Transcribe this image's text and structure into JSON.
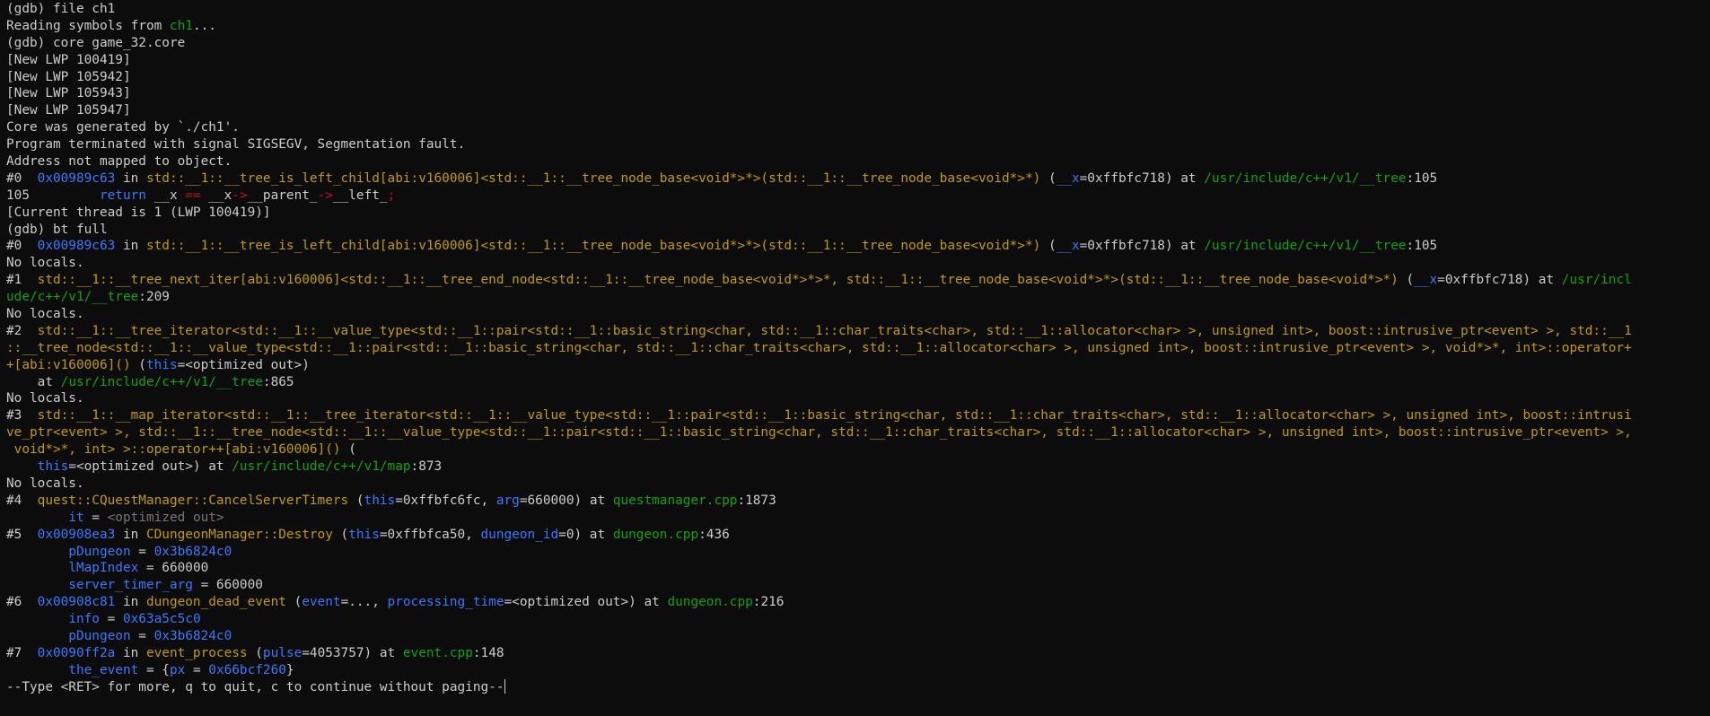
{
  "window": {
    "type": "terminal",
    "program": "gdb"
  },
  "colors": {
    "background": "#0c0c0c",
    "default": "#cccccc",
    "function": "#c19c00",
    "address": "#3b78ff",
    "parameter": "#3b78ff",
    "file": "#13a10e",
    "operator": "#c50f1f",
    "keyword": "#3b78ff",
    "variable": "#3b78ff",
    "dim": "#767676"
  },
  "lines": [
    [
      {
        "t": "(gdb) file ch1",
        "c": "default"
      }
    ],
    [
      {
        "t": "Reading symbols from ",
        "c": "default"
      },
      {
        "t": "ch1",
        "c": "file"
      },
      {
        "t": "...",
        "c": "default"
      }
    ],
    [
      {
        "t": "(gdb) core game_32.core",
        "c": "default"
      }
    ],
    [
      {
        "t": "[New LWP 100419]",
        "c": "default"
      }
    ],
    [
      {
        "t": "[New LWP 105942]",
        "c": "default"
      }
    ],
    [
      {
        "t": "[New LWP 105943]",
        "c": "default"
      }
    ],
    [
      {
        "t": "[New LWP 105947]",
        "c": "default"
      }
    ],
    [
      {
        "t": "Core was generated by `./ch1'.",
        "c": "default"
      }
    ],
    [
      {
        "t": "Program terminated with signal SIGSEGV, Segmentation fault.",
        "c": "default"
      }
    ],
    [
      {
        "t": "Address not mapped to object.",
        "c": "default"
      }
    ],
    [
      {
        "t": "#0  ",
        "c": "default"
      },
      {
        "t": "0x00989c63",
        "c": "addr"
      },
      {
        "t": " in ",
        "c": "default"
      },
      {
        "t": "std::__1::__tree_is_left_child[abi:v160006]<std::__1::__tree_node_base<void*>*>(std::__1::__tree_node_base<void*>*)",
        "c": "fn"
      },
      {
        "t": " (",
        "c": "default"
      },
      {
        "t": "__x",
        "c": "param"
      },
      {
        "t": "=0xffbfc718) at ",
        "c": "default"
      },
      {
        "t": "/usr/include/c++/v1/__tree",
        "c": "file"
      },
      {
        "t": ":105",
        "c": "default"
      }
    ],
    [
      {
        "t": "105\t    ",
        "c": "default"
      },
      {
        "t": "return",
        "c": "kw"
      },
      {
        "t": " __x ",
        "c": "default"
      },
      {
        "t": "==",
        "c": "op"
      },
      {
        "t": " __x",
        "c": "default"
      },
      {
        "t": "->",
        "c": "op"
      },
      {
        "t": "__parent_",
        "c": "default"
      },
      {
        "t": "->",
        "c": "op"
      },
      {
        "t": "__left_",
        "c": "default"
      },
      {
        "t": ";",
        "c": "op"
      }
    ],
    [
      {
        "t": "[Current thread is 1 (LWP 100419)]",
        "c": "default"
      }
    ],
    [
      {
        "t": "(gdb) bt full",
        "c": "default"
      }
    ],
    [
      {
        "t": "#0  ",
        "c": "default"
      },
      {
        "t": "0x00989c63",
        "c": "addr"
      },
      {
        "t": " in ",
        "c": "default"
      },
      {
        "t": "std::__1::__tree_is_left_child[abi:v160006]<std::__1::__tree_node_base<void*>*>(std::__1::__tree_node_base<void*>*)",
        "c": "fn"
      },
      {
        "t": " (",
        "c": "default"
      },
      {
        "t": "__x",
        "c": "param"
      },
      {
        "t": "=0xffbfc718) at ",
        "c": "default"
      },
      {
        "t": "/usr/include/c++/v1/__tree",
        "c": "file"
      },
      {
        "t": ":105",
        "c": "default"
      }
    ],
    [
      {
        "t": "No locals.",
        "c": "default"
      }
    ],
    [
      {
        "t": "#1  ",
        "c": "default"
      },
      {
        "t": "std::__1::__tree_next_iter[abi:v160006]<std::__1::__tree_end_node<std::__1::__tree_node_base<void*>*>*, std::__1::__tree_node_base<void*>*>(std::__1::__tree_node_base<void*>*)",
        "c": "fn"
      },
      {
        "t": " (",
        "c": "default"
      },
      {
        "t": "__x",
        "c": "param"
      },
      {
        "t": "=0xffbfc718) at ",
        "c": "default"
      },
      {
        "t": "/usr/incl",
        "c": "file"
      }
    ],
    [
      {
        "t": "ude/c++/v1/__tree",
        "c": "file"
      },
      {
        "t": ":209",
        "c": "default"
      }
    ],
    [
      {
        "t": "No locals.",
        "c": "default"
      }
    ],
    [
      {
        "t": "#2  ",
        "c": "default"
      },
      {
        "t": "std::__1::__tree_iterator<std::__1::__value_type<std::__1::pair<std::__1::basic_string<char, std::__1::char_traits<char>, std::__1::allocator<char> >, unsigned int>, boost::intrusive_ptr<event> >, std::__1",
        "c": "fn"
      }
    ],
    [
      {
        "t": "::__tree_node<std::__1::__value_type<std::__1::pair<std::__1::basic_string<char, std::__1::char_traits<char>, std::__1::allocator<char> >, unsigned int>, boost::intrusive_ptr<event> >, void*>*, int>::operator+",
        "c": "fn"
      }
    ],
    [
      {
        "t": "+[abi:v160006]()",
        "c": "fn"
      },
      {
        "t": " (",
        "c": "default"
      },
      {
        "t": "this",
        "c": "param"
      },
      {
        "t": "=<optimized out>)",
        "c": "default"
      }
    ],
    [
      {
        "t": "    at ",
        "c": "default"
      },
      {
        "t": "/usr/include/c++/v1/__tree",
        "c": "file"
      },
      {
        "t": ":865",
        "c": "default"
      }
    ],
    [
      {
        "t": "No locals.",
        "c": "default"
      }
    ],
    [
      {
        "t": "#3  ",
        "c": "default"
      },
      {
        "t": "std::__1::__map_iterator<std::__1::__tree_iterator<std::__1::__value_type<std::__1::pair<std::__1::basic_string<char, std::__1::char_traits<char>, std::__1::allocator<char> >, unsigned int>, boost::intrusi",
        "c": "fn"
      }
    ],
    [
      {
        "t": "ve_ptr<event> >, std::__1::__tree_node<std::__1::__value_type<std::__1::pair<std::__1::basic_string<char, std::__1::char_traits<char>, std::__1::allocator<char> >, unsigned int>, boost::intrusive_ptr<event> >,",
        "c": "fn"
      }
    ],
    [
      {
        "t": " void*>*, int> >::operator++[abi:v160006]()",
        "c": "fn"
      },
      {
        "t": " (",
        "c": "default"
      }
    ],
    [
      {
        "t": "    ",
        "c": "default"
      },
      {
        "t": "this",
        "c": "param"
      },
      {
        "t": "=<optimized out>) at ",
        "c": "default"
      },
      {
        "t": "/usr/include/c++/v1/map",
        "c": "file"
      },
      {
        "t": ":873",
        "c": "default"
      }
    ],
    [
      {
        "t": "No locals.",
        "c": "default"
      }
    ],
    [
      {
        "t": "#4  ",
        "c": "default"
      },
      {
        "t": "quest::CQuestManager::CancelServerTimers",
        "c": "fn"
      },
      {
        "t": " (",
        "c": "default"
      },
      {
        "t": "this",
        "c": "param"
      },
      {
        "t": "=0xffbfc6fc, ",
        "c": "default"
      },
      {
        "t": "arg",
        "c": "param"
      },
      {
        "t": "=660000) at ",
        "c": "default"
      },
      {
        "t": "questmanager.cpp",
        "c": "file"
      },
      {
        "t": ":1873",
        "c": "default"
      }
    ],
    [
      {
        "t": "        ",
        "c": "default"
      },
      {
        "t": "it",
        "c": "var"
      },
      {
        "t": " = ",
        "c": "default"
      },
      {
        "t": "<optimized out>",
        "c": "dim"
      }
    ],
    [
      {
        "t": "#5  ",
        "c": "default"
      },
      {
        "t": "0x00908ea3",
        "c": "addr"
      },
      {
        "t": " in ",
        "c": "default"
      },
      {
        "t": "CDungeonManager::Destroy",
        "c": "fn"
      },
      {
        "t": " (",
        "c": "default"
      },
      {
        "t": "this",
        "c": "param"
      },
      {
        "t": "=0xffbfca50, ",
        "c": "default"
      },
      {
        "t": "dungeon_id",
        "c": "param"
      },
      {
        "t": "=0) at ",
        "c": "default"
      },
      {
        "t": "dungeon.cpp",
        "c": "file"
      },
      {
        "t": ":436",
        "c": "default"
      }
    ],
    [
      {
        "t": "        ",
        "c": "default"
      },
      {
        "t": "pDungeon",
        "c": "var"
      },
      {
        "t": " = ",
        "c": "default"
      },
      {
        "t": "0x3b6824c0",
        "c": "addr"
      }
    ],
    [
      {
        "t": "        ",
        "c": "default"
      },
      {
        "t": "lMapIndex",
        "c": "var"
      },
      {
        "t": " = 660000",
        "c": "default"
      }
    ],
    [
      {
        "t": "        ",
        "c": "default"
      },
      {
        "t": "server_timer_arg",
        "c": "var"
      },
      {
        "t": " = 660000",
        "c": "default"
      }
    ],
    [
      {
        "t": "#6  ",
        "c": "default"
      },
      {
        "t": "0x00908c81",
        "c": "addr"
      },
      {
        "t": " in ",
        "c": "default"
      },
      {
        "t": "dungeon_dead_event",
        "c": "fn"
      },
      {
        "t": " (",
        "c": "default"
      },
      {
        "t": "event",
        "c": "param"
      },
      {
        "t": "=..., ",
        "c": "default"
      },
      {
        "t": "processing_time",
        "c": "param"
      },
      {
        "t": "=<optimized out>) at ",
        "c": "default"
      },
      {
        "t": "dungeon.cpp",
        "c": "file"
      },
      {
        "t": ":216",
        "c": "default"
      }
    ],
    [
      {
        "t": "        ",
        "c": "default"
      },
      {
        "t": "info",
        "c": "var"
      },
      {
        "t": " = ",
        "c": "default"
      },
      {
        "t": "0x63a5c5c0",
        "c": "addr"
      }
    ],
    [
      {
        "t": "        ",
        "c": "default"
      },
      {
        "t": "pDungeon",
        "c": "var"
      },
      {
        "t": " = ",
        "c": "default"
      },
      {
        "t": "0x3b6824c0",
        "c": "addr"
      }
    ],
    [
      {
        "t": "#7  ",
        "c": "default"
      },
      {
        "t": "0x0090ff2a",
        "c": "addr"
      },
      {
        "t": " in ",
        "c": "default"
      },
      {
        "t": "event_process",
        "c": "fn"
      },
      {
        "t": " (",
        "c": "default"
      },
      {
        "t": "pulse",
        "c": "param"
      },
      {
        "t": "=4053757) at ",
        "c": "default"
      },
      {
        "t": "event.cpp",
        "c": "file"
      },
      {
        "t": ":148",
        "c": "default"
      }
    ],
    [
      {
        "t": "        ",
        "c": "default"
      },
      {
        "t": "the_event",
        "c": "var"
      },
      {
        "t": " = {",
        "c": "default"
      },
      {
        "t": "px",
        "c": "var"
      },
      {
        "t": " = ",
        "c": "default"
      },
      {
        "t": "0x66bcf260",
        "c": "addr"
      },
      {
        "t": "}",
        "c": "default"
      }
    ],
    [
      {
        "t": "--Type <RET> for more, q to quit, c to continue without paging--",
        "c": "default"
      }
    ]
  ]
}
